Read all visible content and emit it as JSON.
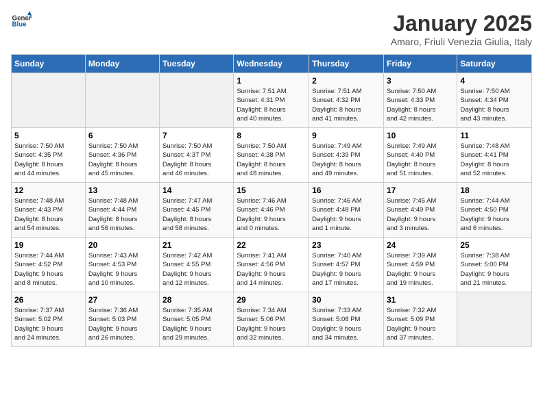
{
  "logo": {
    "text_general": "General",
    "text_blue": "Blue"
  },
  "title": "January 2025",
  "subtitle": "Amaro, Friuli Venezia Giulia, Italy",
  "headers": [
    "Sunday",
    "Monday",
    "Tuesday",
    "Wednesday",
    "Thursday",
    "Friday",
    "Saturday"
  ],
  "weeks": [
    [
      {
        "day": "",
        "info": ""
      },
      {
        "day": "",
        "info": ""
      },
      {
        "day": "",
        "info": ""
      },
      {
        "day": "1",
        "info": "Sunrise: 7:51 AM\nSunset: 4:31 PM\nDaylight: 8 hours\nand 40 minutes."
      },
      {
        "day": "2",
        "info": "Sunrise: 7:51 AM\nSunset: 4:32 PM\nDaylight: 8 hours\nand 41 minutes."
      },
      {
        "day": "3",
        "info": "Sunrise: 7:50 AM\nSunset: 4:33 PM\nDaylight: 8 hours\nand 42 minutes."
      },
      {
        "day": "4",
        "info": "Sunrise: 7:50 AM\nSunset: 4:34 PM\nDaylight: 8 hours\nand 43 minutes."
      }
    ],
    [
      {
        "day": "5",
        "info": "Sunrise: 7:50 AM\nSunset: 4:35 PM\nDaylight: 8 hours\nand 44 minutes."
      },
      {
        "day": "6",
        "info": "Sunrise: 7:50 AM\nSunset: 4:36 PM\nDaylight: 8 hours\nand 45 minutes."
      },
      {
        "day": "7",
        "info": "Sunrise: 7:50 AM\nSunset: 4:37 PM\nDaylight: 8 hours\nand 46 minutes."
      },
      {
        "day": "8",
        "info": "Sunrise: 7:50 AM\nSunset: 4:38 PM\nDaylight: 8 hours\nand 48 minutes."
      },
      {
        "day": "9",
        "info": "Sunrise: 7:49 AM\nSunset: 4:39 PM\nDaylight: 8 hours\nand 49 minutes."
      },
      {
        "day": "10",
        "info": "Sunrise: 7:49 AM\nSunset: 4:40 PM\nDaylight: 8 hours\nand 51 minutes."
      },
      {
        "day": "11",
        "info": "Sunrise: 7:48 AM\nSunset: 4:41 PM\nDaylight: 8 hours\nand 52 minutes."
      }
    ],
    [
      {
        "day": "12",
        "info": "Sunrise: 7:48 AM\nSunset: 4:43 PM\nDaylight: 8 hours\nand 54 minutes."
      },
      {
        "day": "13",
        "info": "Sunrise: 7:48 AM\nSunset: 4:44 PM\nDaylight: 8 hours\nand 56 minutes."
      },
      {
        "day": "14",
        "info": "Sunrise: 7:47 AM\nSunset: 4:45 PM\nDaylight: 8 hours\nand 58 minutes."
      },
      {
        "day": "15",
        "info": "Sunrise: 7:46 AM\nSunset: 4:46 PM\nDaylight: 9 hours\nand 0 minutes."
      },
      {
        "day": "16",
        "info": "Sunrise: 7:46 AM\nSunset: 4:48 PM\nDaylight: 9 hours\nand 1 minute."
      },
      {
        "day": "17",
        "info": "Sunrise: 7:45 AM\nSunset: 4:49 PM\nDaylight: 9 hours\nand 3 minutes."
      },
      {
        "day": "18",
        "info": "Sunrise: 7:44 AM\nSunset: 4:50 PM\nDaylight: 9 hours\nand 6 minutes."
      }
    ],
    [
      {
        "day": "19",
        "info": "Sunrise: 7:44 AM\nSunset: 4:52 PM\nDaylight: 9 hours\nand 8 minutes."
      },
      {
        "day": "20",
        "info": "Sunrise: 7:43 AM\nSunset: 4:53 PM\nDaylight: 9 hours\nand 10 minutes."
      },
      {
        "day": "21",
        "info": "Sunrise: 7:42 AM\nSunset: 4:55 PM\nDaylight: 9 hours\nand 12 minutes."
      },
      {
        "day": "22",
        "info": "Sunrise: 7:41 AM\nSunset: 4:56 PM\nDaylight: 9 hours\nand 14 minutes."
      },
      {
        "day": "23",
        "info": "Sunrise: 7:40 AM\nSunset: 4:57 PM\nDaylight: 9 hours\nand 17 minutes."
      },
      {
        "day": "24",
        "info": "Sunrise: 7:39 AM\nSunset: 4:59 PM\nDaylight: 9 hours\nand 19 minutes."
      },
      {
        "day": "25",
        "info": "Sunrise: 7:38 AM\nSunset: 5:00 PM\nDaylight: 9 hours\nand 21 minutes."
      }
    ],
    [
      {
        "day": "26",
        "info": "Sunrise: 7:37 AM\nSunset: 5:02 PM\nDaylight: 9 hours\nand 24 minutes."
      },
      {
        "day": "27",
        "info": "Sunrise: 7:36 AM\nSunset: 5:03 PM\nDaylight: 9 hours\nand 26 minutes."
      },
      {
        "day": "28",
        "info": "Sunrise: 7:35 AM\nSunset: 5:05 PM\nDaylight: 9 hours\nand 29 minutes."
      },
      {
        "day": "29",
        "info": "Sunrise: 7:34 AM\nSunset: 5:06 PM\nDaylight: 9 hours\nand 32 minutes."
      },
      {
        "day": "30",
        "info": "Sunrise: 7:33 AM\nSunset: 5:08 PM\nDaylight: 9 hours\nand 34 minutes."
      },
      {
        "day": "31",
        "info": "Sunrise: 7:32 AM\nSunset: 5:09 PM\nDaylight: 9 hours\nand 37 minutes."
      },
      {
        "day": "",
        "info": ""
      }
    ]
  ]
}
